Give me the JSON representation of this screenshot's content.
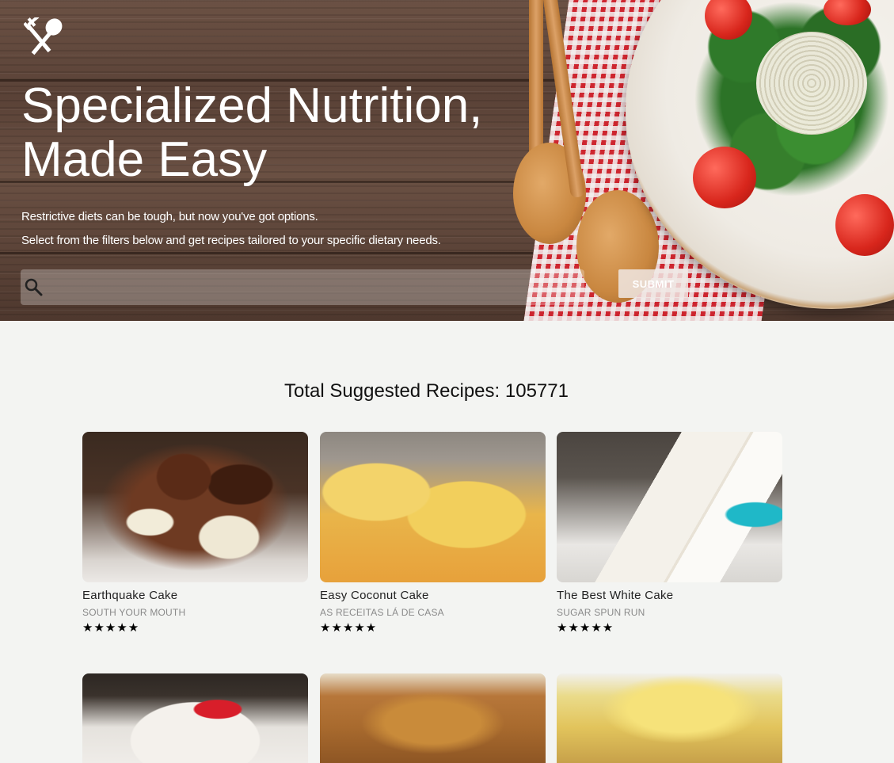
{
  "hero": {
    "headline_line1": "Specialized Nutrition,",
    "headline_line2": "Made Easy",
    "subtitle_line1": "Restrictive diets can be tough, but now you've got options.",
    "subtitle_line2": "Select from the filters below and get recipes tailored to your specific dietary needs.",
    "search": {
      "value": "",
      "placeholder": ""
    },
    "submit_label": "SUBMIT",
    "logo_icon": "fork-spoon-icon"
  },
  "results": {
    "total_label": "Total Suggested Recipes: 105771",
    "recipes": [
      {
        "title": "Earthquake Cake",
        "source": "SOUTH YOUR MOUTH",
        "stars": "★★★★★",
        "rating": 5
      },
      {
        "title": "Easy Coconut Cake",
        "source": "AS RECEITAS LÁ DE CASA",
        "stars": "★★★★★",
        "rating": 5
      },
      {
        "title": "The Best White Cake",
        "source": "SUGAR SPUN RUN",
        "stars": "★★★★★",
        "rating": 5
      },
      {
        "title": "",
        "source": "",
        "stars": ""
      },
      {
        "title": "",
        "source": "",
        "stars": ""
      },
      {
        "title": "",
        "source": "",
        "stars": ""
      }
    ]
  },
  "colors": {
    "page_bg": "#f3f4f2",
    "hero_text": "#ffffff",
    "submit_bg": "#f0e8e4"
  }
}
